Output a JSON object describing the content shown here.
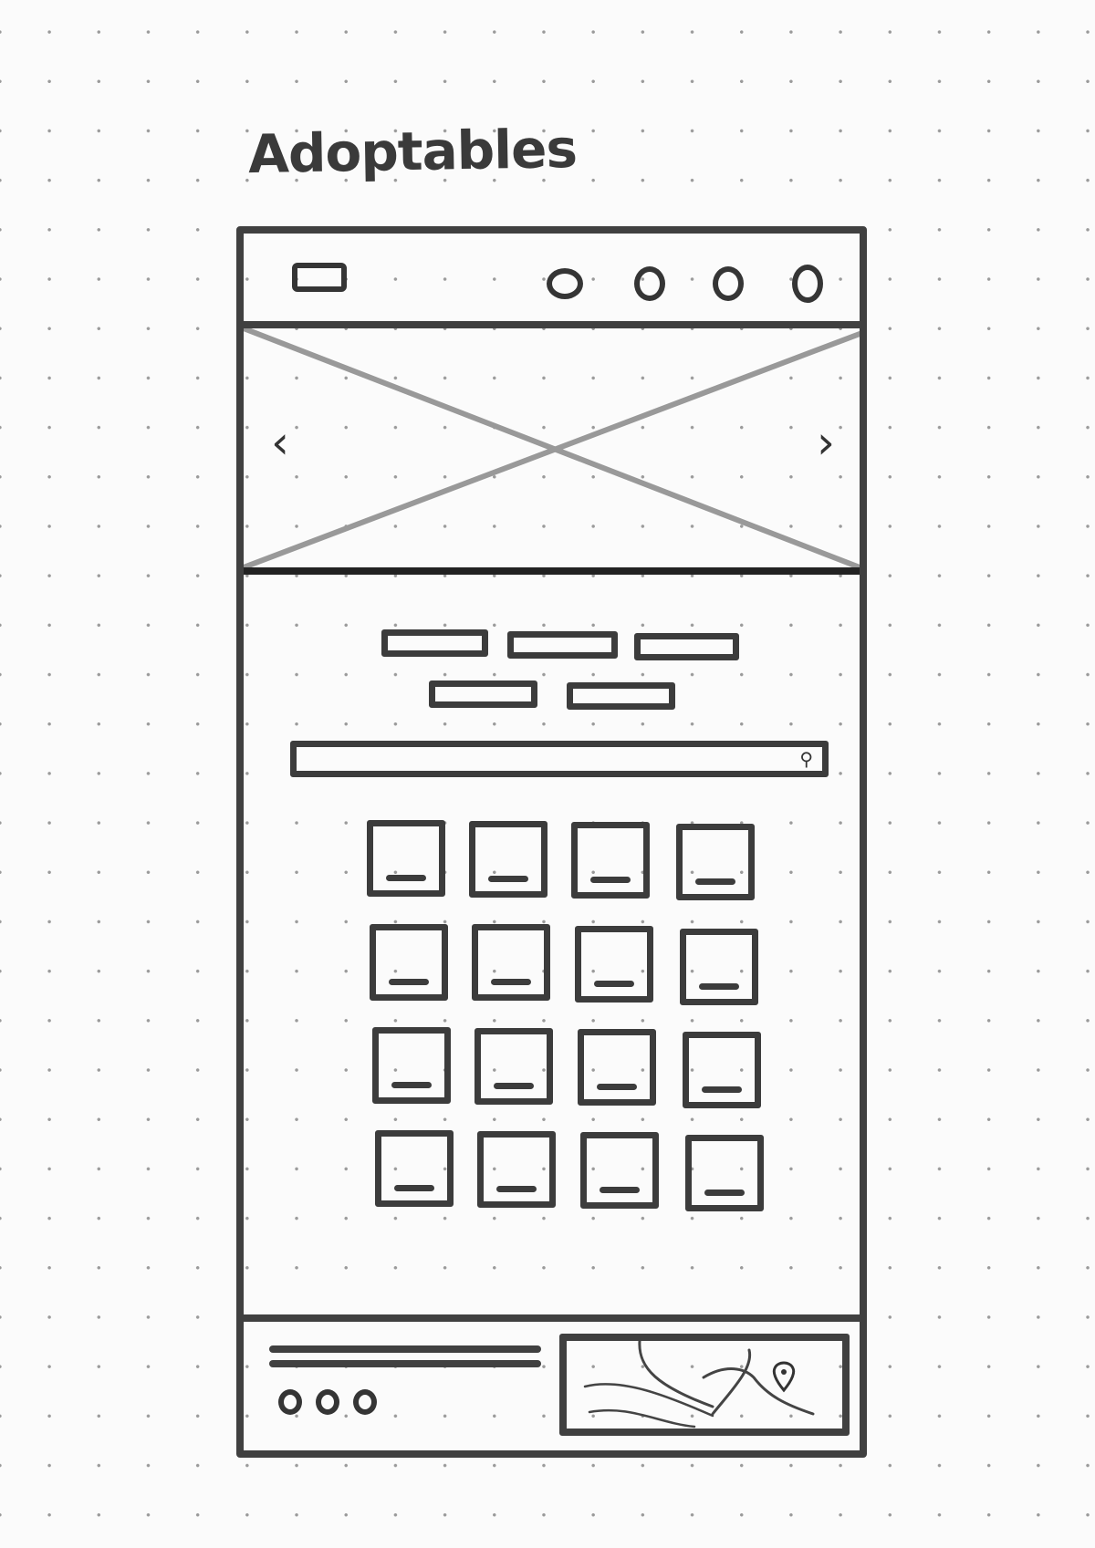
{
  "page": {
    "title": "Adoptables"
  },
  "icons": {
    "prev": "chevron-left-icon",
    "next": "chevron-right-icon",
    "search": "search-icon",
    "map_pin": "map-pin-icon"
  },
  "header": {
    "nav_count": 4
  },
  "hero": {
    "prev_glyph": "‹",
    "next_glyph": "›"
  },
  "filters": {
    "count": 5
  },
  "search": {
    "icon_glyph": "⚲"
  },
  "gallery": {
    "rows": 4,
    "columns": 4
  },
  "footer": {
    "text_lines": 2,
    "social_count": 3
  },
  "colors": {
    "ink": "#404040",
    "placeholder_cross": "#999999",
    "paper": "#fbfbfb"
  }
}
